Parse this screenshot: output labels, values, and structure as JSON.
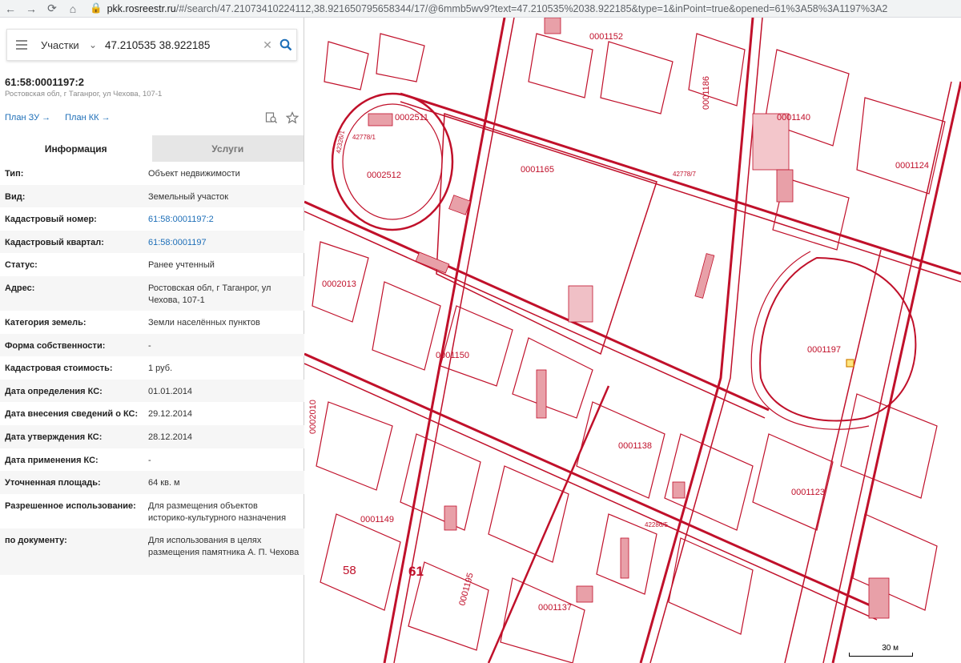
{
  "browser": {
    "url_host": "pkk.rosreestr.ru",
    "url_path": "/#/search/47.21073410224112,38.92165079565834​4/17/@6mmb5wv9?text=47.210535%2038.922185&type=1&inPoint=true&opened=61%3A58%3A1197%3A2"
  },
  "search": {
    "type_label": "Участки",
    "query": "47.210535 38.922185"
  },
  "object": {
    "number": "61:58:0001197:2",
    "address": "Ростовская обл, г Таганрог, ул Чехова, 107-1",
    "plan_zu": "План ЗУ →",
    "plan_kk": "План КК →"
  },
  "tabs": {
    "info": "Информация",
    "services": "Услуги"
  },
  "info": [
    {
      "label": "Тип:",
      "value": "Объект недвижимости"
    },
    {
      "label": "Вид:",
      "value": "Земельный участок"
    },
    {
      "label": "Кадастровый номер:",
      "value": "61:58:0001197:2"
    },
    {
      "label": "Кадастровый квартал:",
      "value": "61:58:0001197"
    },
    {
      "label": "Статус:",
      "value": "Ранее учтенный"
    },
    {
      "label": "Адрес:",
      "value": "Ростовская обл, г Таганрог, ул Чехова, 107-1"
    },
    {
      "label": "Категория земель:",
      "value": "Земли населённых пунктов"
    },
    {
      "label": "Форма собственности:",
      "value": "-"
    },
    {
      "label": "Кадастровая стоимость:",
      "value": "1 руб."
    },
    {
      "label": "Дата определения КС:",
      "value": "01.01.2014"
    },
    {
      "label": "Дата внесения сведений о КС:",
      "value": "29.12.2014"
    },
    {
      "label": "Дата утверждения КС:",
      "value": "28.12.2014"
    },
    {
      "label": "Дата применения КС:",
      "value": "-"
    },
    {
      "label": "Уточненная площадь:",
      "value": "64 кв. м"
    },
    {
      "label": "Разрешенное использование:",
      "value": "Для размещения объектов историко-культурного назначения"
    },
    {
      "label": "по документу:",
      "value": "Для использования в целях размещения памятника А. П. Чехова"
    }
  ],
  "map": {
    "line_color": "#c0102a",
    "fill_color": "#e8a0a8",
    "scale_label": "30 м",
    "labels": [
      "0001152",
      "0001186",
      "0001140",
      "0002511",
      "0002512",
      "0001165",
      "0002013",
      "0001124",
      "0001197",
      "0001150",
      "0001138",
      "0002010",
      "0001149",
      "0001123",
      "0001195",
      "0001137",
      "42778/1",
      "42778/7",
      "42326/1",
      "42286/5",
      "58",
      "61"
    ]
  }
}
